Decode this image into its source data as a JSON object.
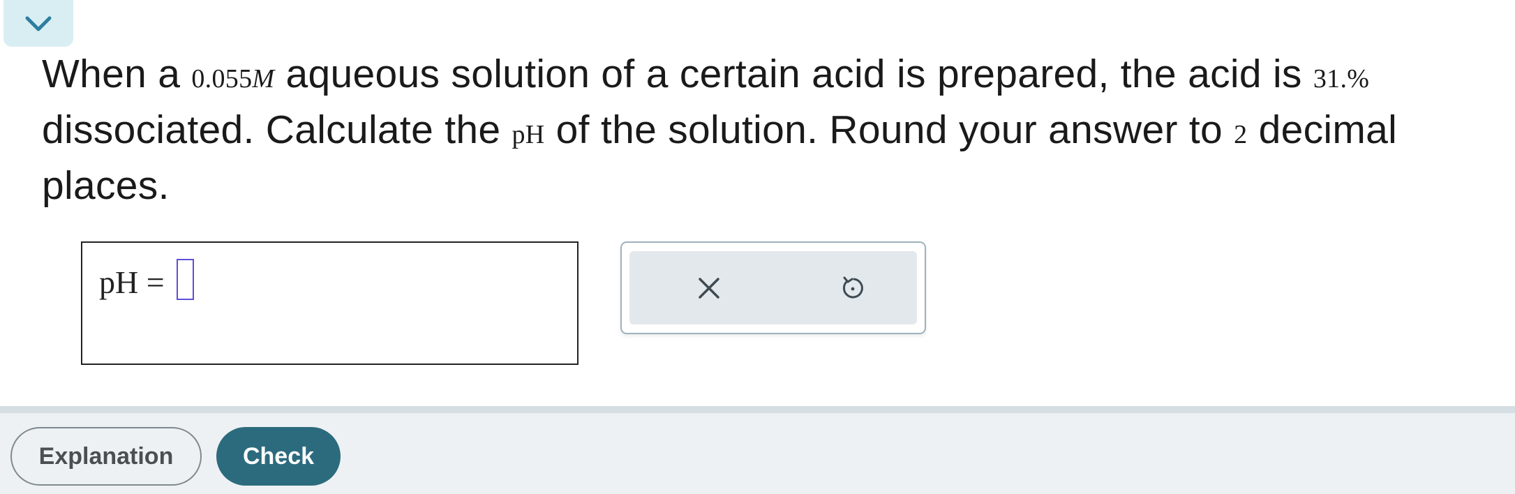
{
  "question": {
    "part1": "When a ",
    "concentration": "0.055",
    "unit": "M",
    "part2": " aqueous solution of a certain acid is prepared, the acid is ",
    "percent": "31.%",
    "part3": " dissociated. Calculate the ",
    "ph_term": "pH",
    "part4": " of the solution. Round your answer to ",
    "places": "2",
    "part5": " decimal places."
  },
  "answer": {
    "label": "pH =",
    "value": ""
  },
  "icons": {
    "collapse": "chevron-down-icon",
    "clear": "close-icon",
    "reset": "undo-icon"
  },
  "footer": {
    "explanation_label": "Explanation",
    "check_label": "Check"
  },
  "colors": {
    "accent": "#2c6b7e",
    "tab_bg": "#d9eef3",
    "input_cursor": "#5b4fd8"
  }
}
